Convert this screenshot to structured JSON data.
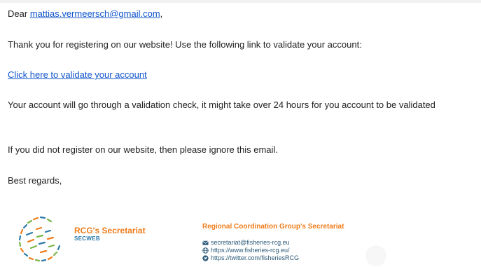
{
  "email": {
    "greeting_prefix": "Dear",
    "recipient": "mattias.vermeersch@gmail.com",
    "greeting_suffix": ",",
    "thanks_line": "Thank you for registering on our website! Use the following link to validate your account:",
    "validate_link": "Click here to validate your account",
    "validation_notice": "Your account will go through a validation check, it might take over 24 hours for you account to be validated",
    "ignore_notice": "If you did not register on our website, then please ignore this email.",
    "closing": "Best regards,"
  },
  "signature": {
    "name": "RCG's Secretariat",
    "subname": "SECWEB",
    "org_title": "Regional Coordination Group's Secretariat",
    "email": "secretariat@fisheries-rcg.eu",
    "website": "https://www.fisheries-rcg.eu/",
    "twitter": "https://twitter.com/fisheriesRCG",
    "icons": {
      "email": "envelope-icon",
      "website": "globe-icon",
      "twitter": "twitter-icon"
    }
  },
  "colors": {
    "link": "#1155cc",
    "signature_orange": "#f07c1a",
    "signature_blue": "#2c7aa8"
  }
}
